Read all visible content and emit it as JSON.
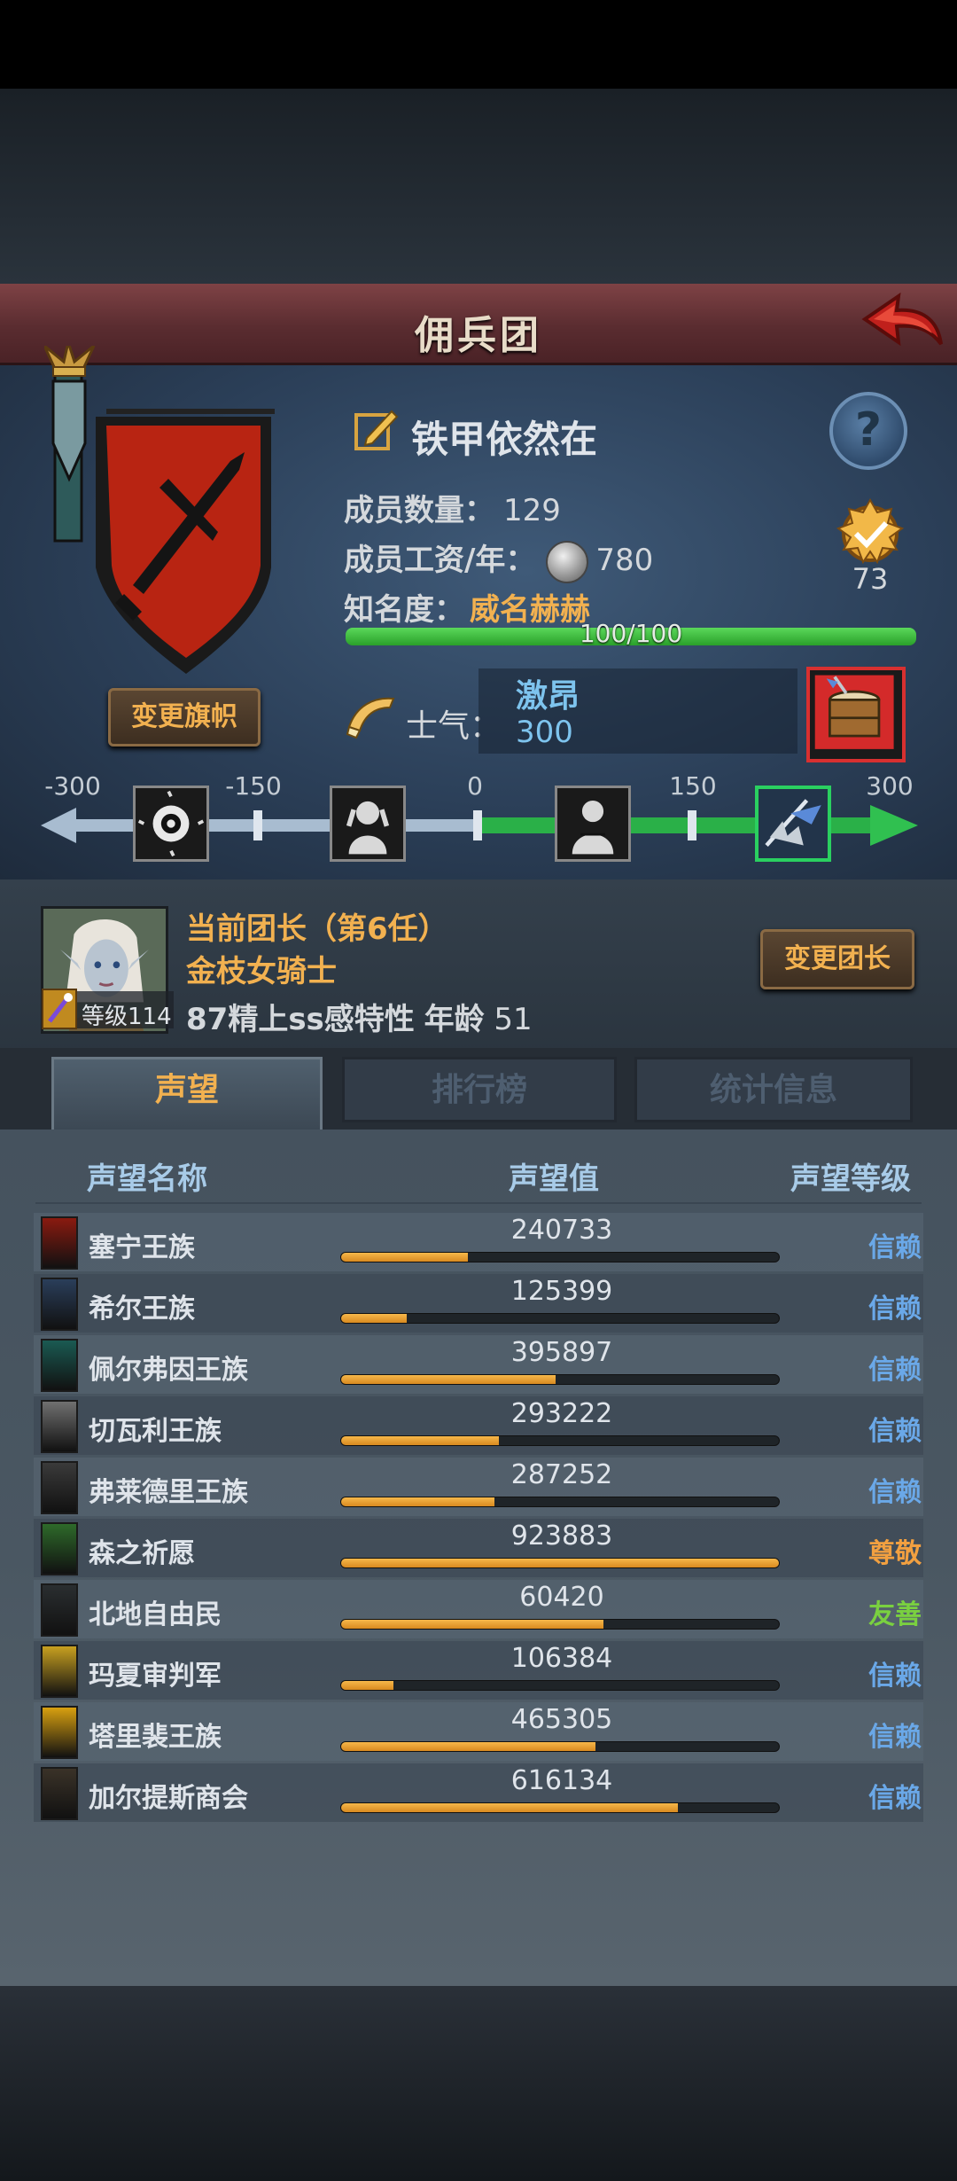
{
  "title": "佣兵团",
  "team": {
    "name": "铁甲依然在",
    "members_label": "成员数量：",
    "members": "129",
    "wage_label": "成员工资/年：",
    "wage": "780",
    "fame_label": "知名度：",
    "fame_state": "威名赫赫",
    "fame_progress": "100/100",
    "fame_fraction": 1.0,
    "badge_value": "73",
    "change_flag_label": "变更旗帜"
  },
  "morale": {
    "label": "士气：",
    "state": "激昂",
    "value": "300",
    "scale_ticks": [
      "-300",
      "-150",
      "0",
      "150",
      "300"
    ],
    "scale_icons": [
      "eye-icon",
      "despair-icon",
      "calm-icon",
      "charge-icon"
    ]
  },
  "commander": {
    "title": "当前团长（第6任）",
    "name": "金枝女骑士",
    "level_label": "等级",
    "level": "114",
    "traits": "87精上ss感特性",
    "age_label": "年龄",
    "age": "51",
    "change_label": "变更团长"
  },
  "tabs": [
    "声望",
    "排行榜",
    "统计信息"
  ],
  "reputation": {
    "headers": [
      "声望名称",
      "声望值",
      "声望等级"
    ],
    "rows": [
      {
        "name": "塞宁王族",
        "value": "240733",
        "fill": 0.29,
        "level": "信赖",
        "level_color": "#6aa8e8",
        "icon_color": "#8a1a10"
      },
      {
        "name": "希尔王族",
        "value": "125399",
        "fill": 0.15,
        "level": "信赖",
        "level_color": "#6aa8e8",
        "icon_color": "#2a3e5a"
      },
      {
        "name": "佩尔弗因王族",
        "value": "395897",
        "fill": 0.49,
        "level": "信赖",
        "level_color": "#6aa8e8",
        "icon_color": "#1a5a52"
      },
      {
        "name": "切瓦利王族",
        "value": "293222",
        "fill": 0.36,
        "level": "信赖",
        "level_color": "#6aa8e8",
        "icon_color": "#707070"
      },
      {
        "name": "弗莱德里王族",
        "value": "287252",
        "fill": 0.35,
        "level": "信赖",
        "level_color": "#6aa8e8",
        "icon_color": "#3a3a3a"
      },
      {
        "name": "森之祈愿",
        "value": "923883",
        "fill": 1.0,
        "level": "尊敬",
        "level_color": "#f2a040",
        "icon_color": "#2e6a2a"
      },
      {
        "name": "北地自由民",
        "value": "60420",
        "fill": 0.6,
        "level": "友善",
        "level_color": "#7ad040",
        "icon_color": "#2a2e30"
      },
      {
        "name": "玛夏审判军",
        "value": "106384",
        "fill": 0.12,
        "level": "信赖",
        "level_color": "#6aa8e8",
        "icon_color": "#c8a020"
      },
      {
        "name": "塔里裴王族",
        "value": "465305",
        "fill": 0.58,
        "level": "信赖",
        "level_color": "#6aa8e8",
        "icon_color": "#d8a010"
      },
      {
        "name": "加尔提斯商会",
        "value": "616134",
        "fill": 0.77,
        "level": "信赖",
        "level_color": "#6aa8e8",
        "icon_color": "#3a3228"
      }
    ]
  }
}
